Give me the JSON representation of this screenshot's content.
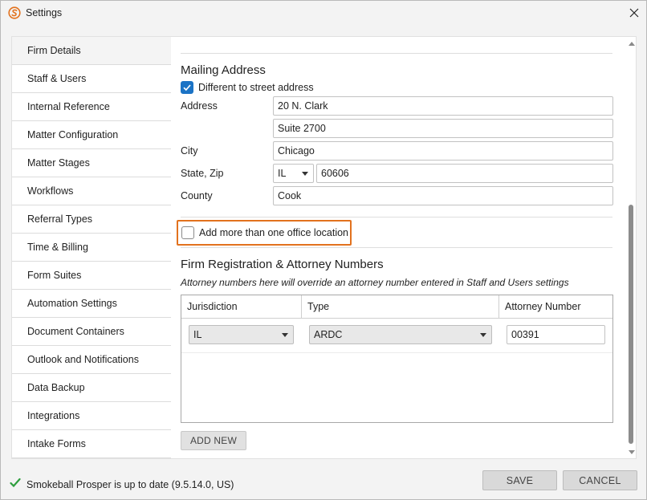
{
  "window": {
    "title": "Settings"
  },
  "sidebar": {
    "items": [
      {
        "label": "Firm Details"
      },
      {
        "label": "Staff & Users"
      },
      {
        "label": "Internal Reference"
      },
      {
        "label": "Matter Configuration"
      },
      {
        "label": "Matter Stages"
      },
      {
        "label": "Workflows"
      },
      {
        "label": "Referral Types"
      },
      {
        "label": "Time & Billing"
      },
      {
        "label": "Form Suites"
      },
      {
        "label": "Automation Settings"
      },
      {
        "label": "Document Containers"
      },
      {
        "label": "Outlook and Notifications"
      },
      {
        "label": "Data Backup"
      },
      {
        "label": "Integrations"
      },
      {
        "label": "Intake Forms"
      }
    ]
  },
  "mailing": {
    "title": "Mailing Address",
    "different_checkbox_label": "Different to street address",
    "different_checked": true,
    "address_label": "Address",
    "address_line1": "20 N. Clark",
    "address_line2": "Suite 2700",
    "city_label": "City",
    "city": "Chicago",
    "state_zip_label": "State, Zip",
    "state": "IL",
    "zip": "60606",
    "county_label": "County",
    "county": "Cook"
  },
  "office": {
    "multiple_checkbox_label": "Add more than one office location",
    "multiple_checked": false,
    "highlight_color": "#e2721e"
  },
  "registration": {
    "title": "Firm Registration & Attorney Numbers",
    "note": "Attorney numbers here will override an attorney number entered in Staff and Users settings",
    "columns": [
      "Jurisdiction",
      "Type",
      "Attorney Number"
    ],
    "rows": [
      {
        "jurisdiction": "IL",
        "type": "ARDC",
        "attorney_number": "00391"
      }
    ],
    "add_new_label": "ADD NEW"
  },
  "footer": {
    "status": "Smokeball Prosper is up to date (9.5.14.0, US)",
    "save_label": "SAVE",
    "cancel_label": "CANCEL"
  },
  "icons": {
    "app": "smokeball-logo-icon",
    "close": "close-icon",
    "status": "checkmark-icon",
    "dropdown": "chevron-down-icon"
  },
  "colors": {
    "accent": "#1b73c5",
    "status_ok": "#2e9e3e",
    "logo": "#e2721e"
  }
}
